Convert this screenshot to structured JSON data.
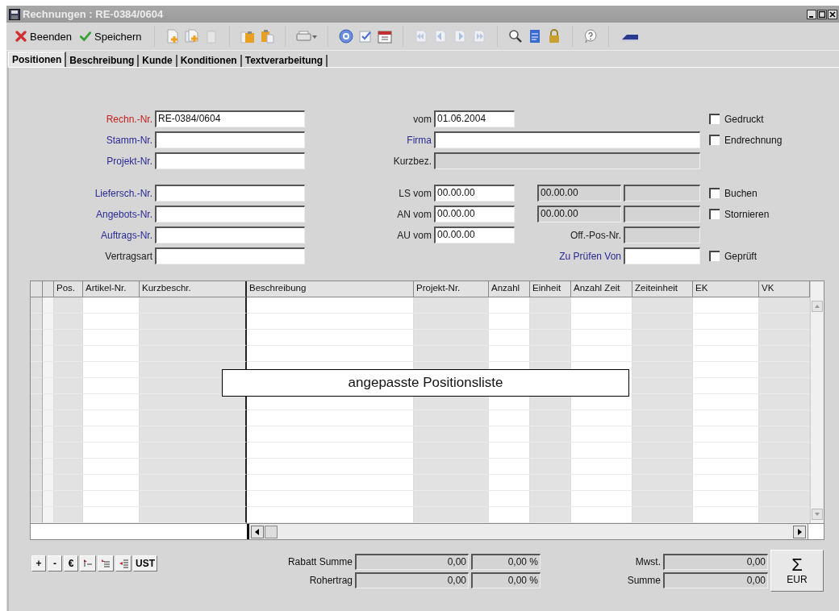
{
  "window": {
    "title": "Rechnungen : RE-0384/0604"
  },
  "toolbar": {
    "buttons": [
      {
        "kind": "close",
        "label": "Beenden"
      },
      {
        "kind": "save",
        "label": "Speichern"
      }
    ]
  },
  "tabs": [
    {
      "label": "Positionen",
      "selected": true
    },
    {
      "label": "Beschreibung",
      "selected": false
    },
    {
      "label": "Kunde",
      "selected": false
    },
    {
      "label": "Konditionen",
      "selected": false
    },
    {
      "label": "Textverarbeitung",
      "selected": false
    }
  ],
  "form": {
    "groups": [
      [
        {
          "left": {
            "label": "Rechn.-Nr.",
            "color": "#c81e1e",
            "value": "RE-0384/0604",
            "disabled": false
          },
          "fields": [
            {
              "kind": "short",
              "label": "vom",
              "color": "#202020",
              "value": "01.06.2004",
              "disabled": false
            }
          ],
          "check": {
            "label": "Gedruckt",
            "checked": false
          }
        },
        {
          "left": {
            "label": "Stamm-Nr.",
            "color": "#2a2a96",
            "disabled": false
          },
          "fields": [
            {
              "kind": "wide",
              "label": "Firma",
              "color": "#2a2a96",
              "disabled": false
            }
          ],
          "check": {
            "label": "Endrechnung",
            "checked": false
          }
        },
        {
          "left": {
            "label": "Projekt-Nr.",
            "color": "#2a2a96",
            "disabled": false
          },
          "fields": [
            {
              "kind": "wide",
              "label": "Kurzbez.",
              "color": "#202020",
              "disabled": true
            }
          ]
        }
      ],
      [
        {
          "left": {
            "label": "Liefersch.-Nr.",
            "color": "#2a2a96",
            "disabled": false
          },
          "fields": [
            {
              "kind": "short",
              "label": "LS vom",
              "color": "#202020",
              "value": "00.00.00",
              "disabled": false
            },
            {
              "kind": "date",
              "value": "00.00.00",
              "disabled": true
            },
            {
              "kind": "info",
              "disabled": true
            }
          ],
          "check": {
            "label": "Buchen",
            "checked": false
          }
        },
        {
          "left": {
            "label": "Angebots-Nr.",
            "color": "#2a2a96",
            "disabled": false
          },
          "fields": [
            {
              "kind": "short",
              "label": "AN vom",
              "color": "#202020",
              "value": "00.00.00",
              "disabled": false
            },
            {
              "kind": "date",
              "value": "00.00.00",
              "disabled": true
            },
            {
              "kind": "info",
              "disabled": true
            }
          ],
          "check": {
            "label": "Stornieren",
            "checked": false
          }
        },
        {
          "left": {
            "label": "Auftrags-Nr.",
            "color": "#2a2a96",
            "disabled": false
          },
          "fields": [
            {
              "kind": "short",
              "label": "AU vom",
              "color": "#202020",
              "value": "00.00.00",
              "disabled": false
            },
            {
              "kind": "side",
              "label": "Off.-Pos-Nr.",
              "color": "#202020",
              "disabled": true
            }
          ]
        },
        {
          "left": {
            "label": "Vertragsart",
            "color": "#202020",
            "disabled": false
          },
          "fields": [
            {
              "kind": "side",
              "label": "Zu Prüfen Von",
              "color": "#2a2a96",
              "disabled": false
            }
          ],
          "check": {
            "label": "Geprüft",
            "checked": false
          }
        }
      ]
    ]
  },
  "table": {
    "columns": [
      {
        "label": "Pos.",
        "readonly": true
      },
      {
        "label": "Artikel-Nr.",
        "readonly": false
      },
      {
        "label": "Kurzbeschr.",
        "readonly": true
      },
      {
        "label": "Beschreibung",
        "readonly": false
      },
      {
        "label": "Projekt-Nr.",
        "readonly": true
      },
      {
        "label": "Anzahl",
        "readonly": false
      },
      {
        "label": "Einheit",
        "readonly": true
      },
      {
        "label": "Anzahl Zeit",
        "readonly": false
      },
      {
        "label": "Zeiteinheit",
        "readonly": true
      },
      {
        "label": "EK",
        "readonly": false
      },
      {
        "label": "VK",
        "readonly": true
      }
    ],
    "overlay": "angepasste Positionsliste"
  },
  "list_tools": [
    {
      "kind": "text",
      "label": "+"
    },
    {
      "kind": "text",
      "label": "-"
    },
    {
      "kind": "text",
      "label": "€"
    },
    {
      "kind": "icon"
    },
    {
      "kind": "icon"
    },
    {
      "kind": "icon"
    },
    {
      "kind": "text",
      "label": "UST"
    }
  ],
  "totals": {
    "left": [
      {
        "label": "Rabatt Summe",
        "value": "0,00",
        "percent": "0,00 %"
      },
      {
        "label": "Rohertrag",
        "value": "0,00",
        "percent": "0,00 %"
      }
    ],
    "right": [
      {
        "label": "Mwst.",
        "value": "0,00"
      },
      {
        "label": "Summe",
        "value": "0,00"
      }
    ],
    "sum_button": {
      "symbol": "Σ",
      "label": "EUR"
    }
  }
}
